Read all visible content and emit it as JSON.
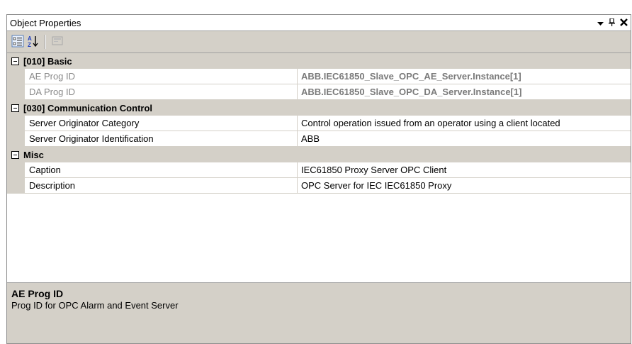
{
  "window": {
    "title": "Object Properties",
    "controls": [
      "dropdown-icon",
      "pin-icon",
      "close-icon"
    ]
  },
  "toolbar": {
    "buttons": [
      {
        "icon": "categorized-icon"
      },
      {
        "icon": "alphabetical-sort-icon"
      },
      {
        "icon": "property-pages-icon",
        "enabled": false
      }
    ]
  },
  "categories": [
    {
      "label": "[010] Basic",
      "properties": [
        {
          "name": "AE Prog ID",
          "value": "ABB.IEC61850_Slave_OPC_AE_Server.Instance[1]",
          "readonly": true
        },
        {
          "name": "DA Prog ID",
          "value": "ABB.IEC61850_Slave_OPC_DA_Server.Instance[1]",
          "readonly": true
        }
      ]
    },
    {
      "label": "[030] Communication Control",
      "properties": [
        {
          "name": "Server Originator Category",
          "value": "Control operation issued from an operator using a client located",
          "readonly": false
        },
        {
          "name": "Server Originator Identification",
          "value": "ABB",
          "readonly": false
        }
      ]
    },
    {
      "label": "Misc",
      "properties": [
        {
          "name": "Caption",
          "value": "IEC61850 Proxy Server OPC Client",
          "readonly": false
        },
        {
          "name": "Description",
          "value": "OPC Server for IEC IEC61850 Proxy",
          "readonly": false
        }
      ]
    }
  ],
  "description": {
    "title": "AE Prog ID",
    "text": "Prog ID for OPC Alarm and Event Server"
  },
  "colors": {
    "panel_bg": "#d4d0c8",
    "grid_bg": "#ffffff",
    "readonly_text": "#7a7a7a"
  }
}
